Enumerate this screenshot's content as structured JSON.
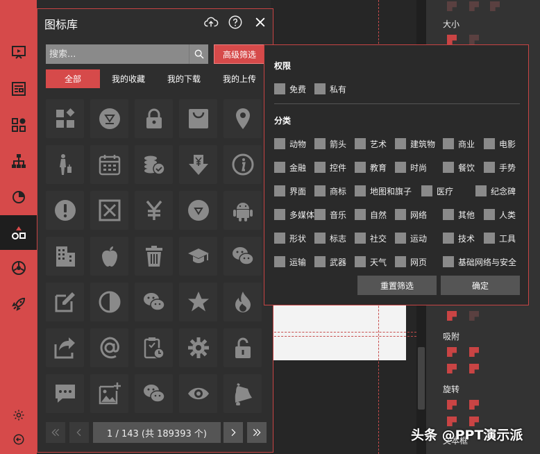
{
  "panel": {
    "title": "图标库",
    "search_placeholder": "搜索...",
    "advanced_filter": "高级筛选",
    "tabs": [
      "全部",
      "我的收藏",
      "我的下载",
      "我的上传"
    ]
  },
  "icons": [
    [
      "grid-icon",
      "navigate-circle-icon",
      "lock-icon",
      "shopping-bag-icon",
      "location-pin-icon"
    ],
    [
      "person-luggage-icon",
      "calendar-icon",
      "coins-check-icon",
      "yen-down-arrow-icon",
      "info-circle-icon"
    ],
    [
      "exclamation-circle-icon",
      "close-box-icon",
      "yen-icon",
      "triangle-circle-icon",
      "android-icon"
    ],
    [
      "buildings-icon",
      "apple-icon",
      "trash-icon",
      "graduation-cap-icon",
      "wechat-icon"
    ],
    [
      "edit-square-icon",
      "half-circle-icon",
      "wechat-icon",
      "star-icon",
      "fire-icon"
    ],
    [
      "share-icon",
      "at-icon",
      "clipboard-clock-icon",
      "gear-icon",
      "unlock-icon"
    ],
    [
      "comment-dots-icon",
      "image-add-icon",
      "wechat-icon",
      "eye-icon",
      "bell-icon"
    ]
  ],
  "pager": {
    "info": "1 / 143 (共 189393 个)"
  },
  "filter": {
    "permission_title": "权限",
    "permission": [
      "免费",
      "私有"
    ],
    "category_title": "分类",
    "categories": [
      [
        "动物",
        "箭头",
        "艺术",
        "建筑物",
        "商业",
        "电影"
      ],
      [
        "金融",
        "控件",
        "教育",
        "时尚",
        "餐饮",
        "手势"
      ],
      [
        "界面",
        "商标",
        "地图和旗子",
        "医疗",
        "纪念碑"
      ],
      [
        "多媒体",
        "音乐",
        "自然",
        "网络",
        "其他",
        "人类"
      ],
      [
        "形状",
        "标志",
        "社交",
        "运动",
        "技术",
        "工具"
      ],
      [
        "运输",
        "武器",
        "天气",
        "网页",
        "基础网络与安全"
      ]
    ],
    "reset": "重置筛选",
    "confirm": "确定"
  },
  "right_panel": {
    "size": "大小",
    "snap": "吸附",
    "rotate": "旋转",
    "textbox": "文本框"
  },
  "watermark": "头条 @PPT演示派",
  "colors": {
    "accent": "#d64a4a",
    "panel": "#2e2e2e",
    "checkbox": "#8a8a8a"
  }
}
